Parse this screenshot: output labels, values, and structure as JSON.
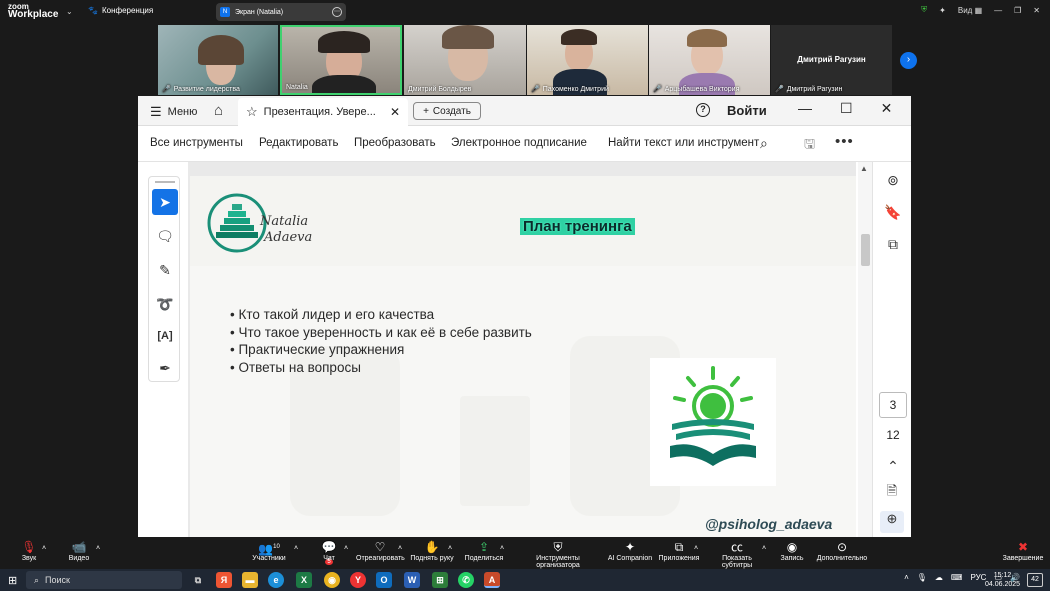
{
  "zoom": {
    "logo_line1": "zoom",
    "logo_line2": "Workplace",
    "conference_label": "Конференция",
    "share_label": "Экран (Natalia)",
    "share_initial": "N",
    "view_label": "Вид",
    "participants": [
      {
        "name": "Развитие лидерства",
        "muted": true
      },
      {
        "name": "Natalia",
        "muted": false
      },
      {
        "name": "Дмитрий Болдырев",
        "muted": false
      },
      {
        "name": "Пахоменко Дмитрий",
        "muted": true
      },
      {
        "name": "Арцыбашева Виктория",
        "muted": true
      },
      {
        "name": "Дмитрий Рагузин",
        "muted": true
      }
    ],
    "blank_tile_title": "Дмитрий Рагузин",
    "bottom": {
      "audio": "Звук",
      "video": "Видео",
      "participants": "Участники",
      "participants_count": "10",
      "chat": "Чат",
      "chat_badge": "5",
      "react": "Отреагировать",
      "raise_hand": "Поднять руку",
      "share": "Поделиться",
      "host_tools": "Инструменты организатора",
      "ai": "AI Companion",
      "apps": "Приложения",
      "captions": "Показать субтитры",
      "record": "Запись",
      "more": "Дополнительно",
      "end": "Завершение"
    }
  },
  "acrobat": {
    "menu_label": "Меню",
    "tab_title": "Презентация. Увере...",
    "create_label": "Создать",
    "login_label": "Войти",
    "toolbar": {
      "all_tools": "Все инструменты",
      "edit": "Редактировать",
      "convert": "Преобразовать",
      "esign": "Электронное подписание",
      "find": "Найти текст или инструмент"
    },
    "page_current": "3",
    "page_total": "12"
  },
  "slide": {
    "brand_line1": "Natalia",
    "brand_line2": "Adaeva",
    "title": "План тренинга",
    "bullets": [
      "• Кто такой лидер и его качества",
      "• Что такое уверенность и как её в себе развить",
      "• Практические упражнения",
      "• Ответы на вопросы"
    ],
    "handle": "@psiholog_adaeva"
  },
  "taskbar": {
    "search_label": "Поиск",
    "lang": "РУС",
    "time": "15:12",
    "date": "04.06.2025",
    "notifications": "42"
  },
  "colors": {
    "zoom_blue": "#0e72ed",
    "acrobat_blue": "#1473e6",
    "slide_accent": "#2fd0a3",
    "logo_teal": "#1a8f78",
    "logo_green": "#3fbf3f"
  }
}
